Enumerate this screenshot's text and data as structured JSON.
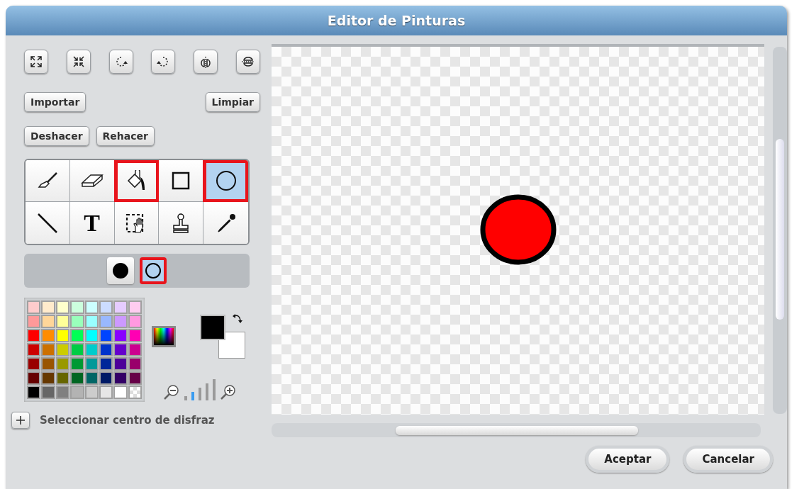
{
  "window": {
    "title": "Editor de Pinturas"
  },
  "toolbar": [
    {
      "kind": "grow"
    },
    {
      "kind": "shrink"
    },
    {
      "kind": "rotate-left"
    },
    {
      "kind": "rotate-right"
    },
    {
      "kind": "flip-horizontal"
    },
    {
      "kind": "flip-vertical"
    }
  ],
  "actions_top": [
    {
      "label": "Importar"
    },
    {
      "label": "Limpiar"
    }
  ],
  "actions_history": [
    {
      "label": "Deshacer"
    },
    {
      "label": "Rehacer"
    }
  ],
  "tools": [
    {
      "kind": "brush",
      "selected": false,
      "highlighted": false
    },
    {
      "kind": "eraser",
      "selected": false,
      "highlighted": false
    },
    {
      "kind": "fill",
      "selected": false,
      "highlighted": true
    },
    {
      "kind": "rectangle",
      "selected": false,
      "highlighted": false
    },
    {
      "kind": "ellipse",
      "selected": true,
      "highlighted": true
    },
    {
      "kind": "line",
      "selected": false,
      "highlighted": false
    },
    {
      "kind": "text",
      "selected": false,
      "highlighted": false,
      "glyph": "T"
    },
    {
      "kind": "select",
      "selected": false,
      "highlighted": false
    },
    {
      "kind": "stamp",
      "selected": false,
      "highlighted": false
    },
    {
      "kind": "eyedropper",
      "selected": false,
      "highlighted": false
    }
  ],
  "fill_options": [
    {
      "kind": "filled",
      "selected": false,
      "highlighted": false
    },
    {
      "kind": "outline",
      "selected": true,
      "highlighted": true
    }
  ],
  "palette": [
    {
      "color": "#ffcccc"
    },
    {
      "color": "#ffebcc"
    },
    {
      "color": "#ffffcc"
    },
    {
      "color": "#ccffdd"
    },
    {
      "color": "#ccffff"
    },
    {
      "color": "#ccdcff"
    },
    {
      "color": "#e6ccff"
    },
    {
      "color": "#ffccf0"
    },
    {
      "color": "#ff9999"
    },
    {
      "color": "#ffd699"
    },
    {
      "color": "#ffff99"
    },
    {
      "color": "#99ffbb"
    },
    {
      "color": "#99ffff"
    },
    {
      "color": "#99b8ff"
    },
    {
      "color": "#cc99ff"
    },
    {
      "color": "#ff99e0"
    },
    {
      "color": "#ff0000"
    },
    {
      "color": "#ff8c00"
    },
    {
      "color": "#ffff00"
    },
    {
      "color": "#00ff55"
    },
    {
      "color": "#00ffff"
    },
    {
      "color": "#0044ff"
    },
    {
      "color": "#8800ff"
    },
    {
      "color": "#ff00b3"
    },
    {
      "color": "#cc0000"
    },
    {
      "color": "#cc7000"
    },
    {
      "color": "#cccc00"
    },
    {
      "color": "#00cc44"
    },
    {
      "color": "#00cccc"
    },
    {
      "color": "#0033cc"
    },
    {
      "color": "#6600cc"
    },
    {
      "color": "#cc008f"
    },
    {
      "color": "#990000"
    },
    {
      "color": "#995400"
    },
    {
      "color": "#999900"
    },
    {
      "color": "#009933"
    },
    {
      "color": "#009999"
    },
    {
      "color": "#002699"
    },
    {
      "color": "#4d0099"
    },
    {
      "color": "#99006b"
    },
    {
      "color": "#660000"
    },
    {
      "color": "#663800"
    },
    {
      "color": "#666600"
    },
    {
      "color": "#006622"
    },
    {
      "color": "#006666"
    },
    {
      "color": "#001a66"
    },
    {
      "color": "#330066"
    },
    {
      "color": "#660047"
    },
    {
      "color": "#000000"
    },
    {
      "color": "#666666"
    },
    {
      "color": "#808080"
    },
    {
      "color": "#b3b3b3"
    },
    {
      "color": "#cccccc"
    },
    {
      "color": "#e6e6e6"
    },
    {
      "color": "#ffffff"
    },
    {
      "kind": "transparent"
    }
  ],
  "pen_colors": [
    {
      "kind": "background",
      "color": "#ffffff"
    },
    {
      "kind": "foreground",
      "color": "#000000"
    }
  ],
  "zoom_levels": [
    {
      "selected": false
    },
    {
      "selected": true
    },
    {
      "selected": false
    },
    {
      "selected": false
    },
    {
      "selected": false
    }
  ],
  "set_center": {
    "label": "Seleccionar centro de disfraz"
  },
  "buttons": [
    {
      "label": "Aceptar"
    },
    {
      "label": "Cancelar"
    }
  ]
}
